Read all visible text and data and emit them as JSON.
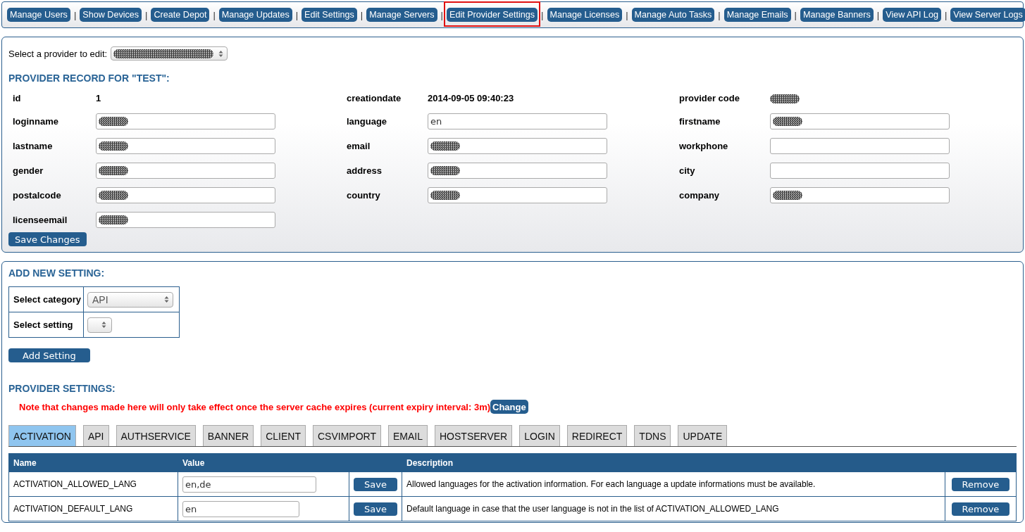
{
  "nav": {
    "items": [
      {
        "label": "Manage Users",
        "highlighted": false
      },
      {
        "separator": "|",
        "label": "Show Devices",
        "highlighted": false
      },
      {
        "separator": "|",
        "label": "Create Depot",
        "highlighted": false
      },
      {
        "separator": "|",
        "label": "Manage Updates",
        "highlighted": false
      },
      {
        "separator": "|",
        "label": "Edit Settings",
        "highlighted": false
      },
      {
        "separator": "|",
        "label": "Manage Servers",
        "highlighted": false
      },
      {
        "separator": "|",
        "label": "Edit Provider Settings",
        "highlighted": true
      },
      {
        "separator": "|",
        "label": "Manage Licenses",
        "highlighted": false
      },
      {
        "separator": "|",
        "label": "Manage Auto Tasks",
        "highlighted": false
      },
      {
        "separator": "|",
        "label": "Manage Emails",
        "highlighted": false
      },
      {
        "separator": "|",
        "label": "Manage Banners",
        "highlighted": false
      },
      {
        "separator": "|",
        "label": "View API Log",
        "highlighted": false
      },
      {
        "separator": "|",
        "label": "View Server Logs",
        "highlighted": false
      }
    ]
  },
  "provider_picker": {
    "label": "Select a provider to edit:",
    "redacted": true
  },
  "record": {
    "title": "PROVIDER RECORD FOR \"TEST\":",
    "fields": [
      {
        "label": "id",
        "kind": "text",
        "value": "1",
        "redacted": false
      },
      {
        "label": "creationdate",
        "kind": "text",
        "value": "2014-09-05 09:40:23",
        "redacted": false
      },
      {
        "label": "provider code",
        "kind": "text",
        "redacted": true
      },
      {
        "label": "loginname",
        "kind": "input",
        "redacted": true
      },
      {
        "label": "language",
        "kind": "input",
        "value": "en",
        "redacted": false
      },
      {
        "label": "firstname",
        "kind": "input",
        "redacted": true
      },
      {
        "label": "lastname",
        "kind": "input",
        "redacted": true
      },
      {
        "label": "email",
        "kind": "input",
        "redacted": true
      },
      {
        "label": "workphone",
        "kind": "input",
        "redacted": false
      },
      {
        "label": "gender",
        "kind": "input",
        "redacted": true
      },
      {
        "label": "address",
        "kind": "input",
        "redacted": true
      },
      {
        "label": "city",
        "kind": "input",
        "redacted": false
      },
      {
        "label": "postalcode",
        "kind": "input",
        "redacted": true
      },
      {
        "label": "country",
        "kind": "input",
        "redacted": true
      },
      {
        "label": "company",
        "kind": "input",
        "redacted": true
      },
      {
        "label": "licenseemail",
        "kind": "input",
        "redacted": true
      }
    ],
    "save_button": "Save Changes"
  },
  "add_setting": {
    "title": "ADD NEW SETTING:",
    "rows": [
      {
        "label": "Select category",
        "value": "API"
      },
      {
        "label": "Select setting"
      }
    ],
    "button": "Add Setting"
  },
  "provider_settings": {
    "title": "PROVIDER SETTINGS:",
    "note": "Note that changes made here will only take effect once the server cache expires (current expiry interval: 3m)",
    "change_button": "Change",
    "tabs": [
      {
        "label": "ACTIVATION",
        "selected": true
      },
      {
        "label": "API",
        "selected": false
      },
      {
        "label": "AUTHSERVICE",
        "selected": false
      },
      {
        "label": "BANNER",
        "selected": false
      },
      {
        "label": "CLIENT",
        "selected": false
      },
      {
        "label": "CSVIMPORT",
        "selected": false
      },
      {
        "label": "EMAIL",
        "selected": false
      },
      {
        "label": "HOSTSERVER",
        "selected": false
      },
      {
        "label": "LOGIN",
        "selected": false
      },
      {
        "label": "REDIRECT",
        "selected": false
      },
      {
        "label": "TDNS",
        "selected": false
      },
      {
        "label": "UPDATE",
        "selected": false
      }
    ],
    "table": {
      "columns": [
        "Name",
        "Value",
        "Description"
      ],
      "rows": [
        {
          "name": "ACTIVATION_ALLOWED_LANG",
          "value": "en,de",
          "save": "Save",
          "description": "Allowed languages for the activation information. For each language a update informations must be available.",
          "remove": "Remove"
        },
        {
          "name": "ACTIVATION_DEFAULT_LANG",
          "value": "en",
          "save": "Save",
          "description": "Default language in case that the user language is not in the list of ACTIVATION_ALLOWED_LANG",
          "remove": "Remove"
        }
      ]
    }
  }
}
